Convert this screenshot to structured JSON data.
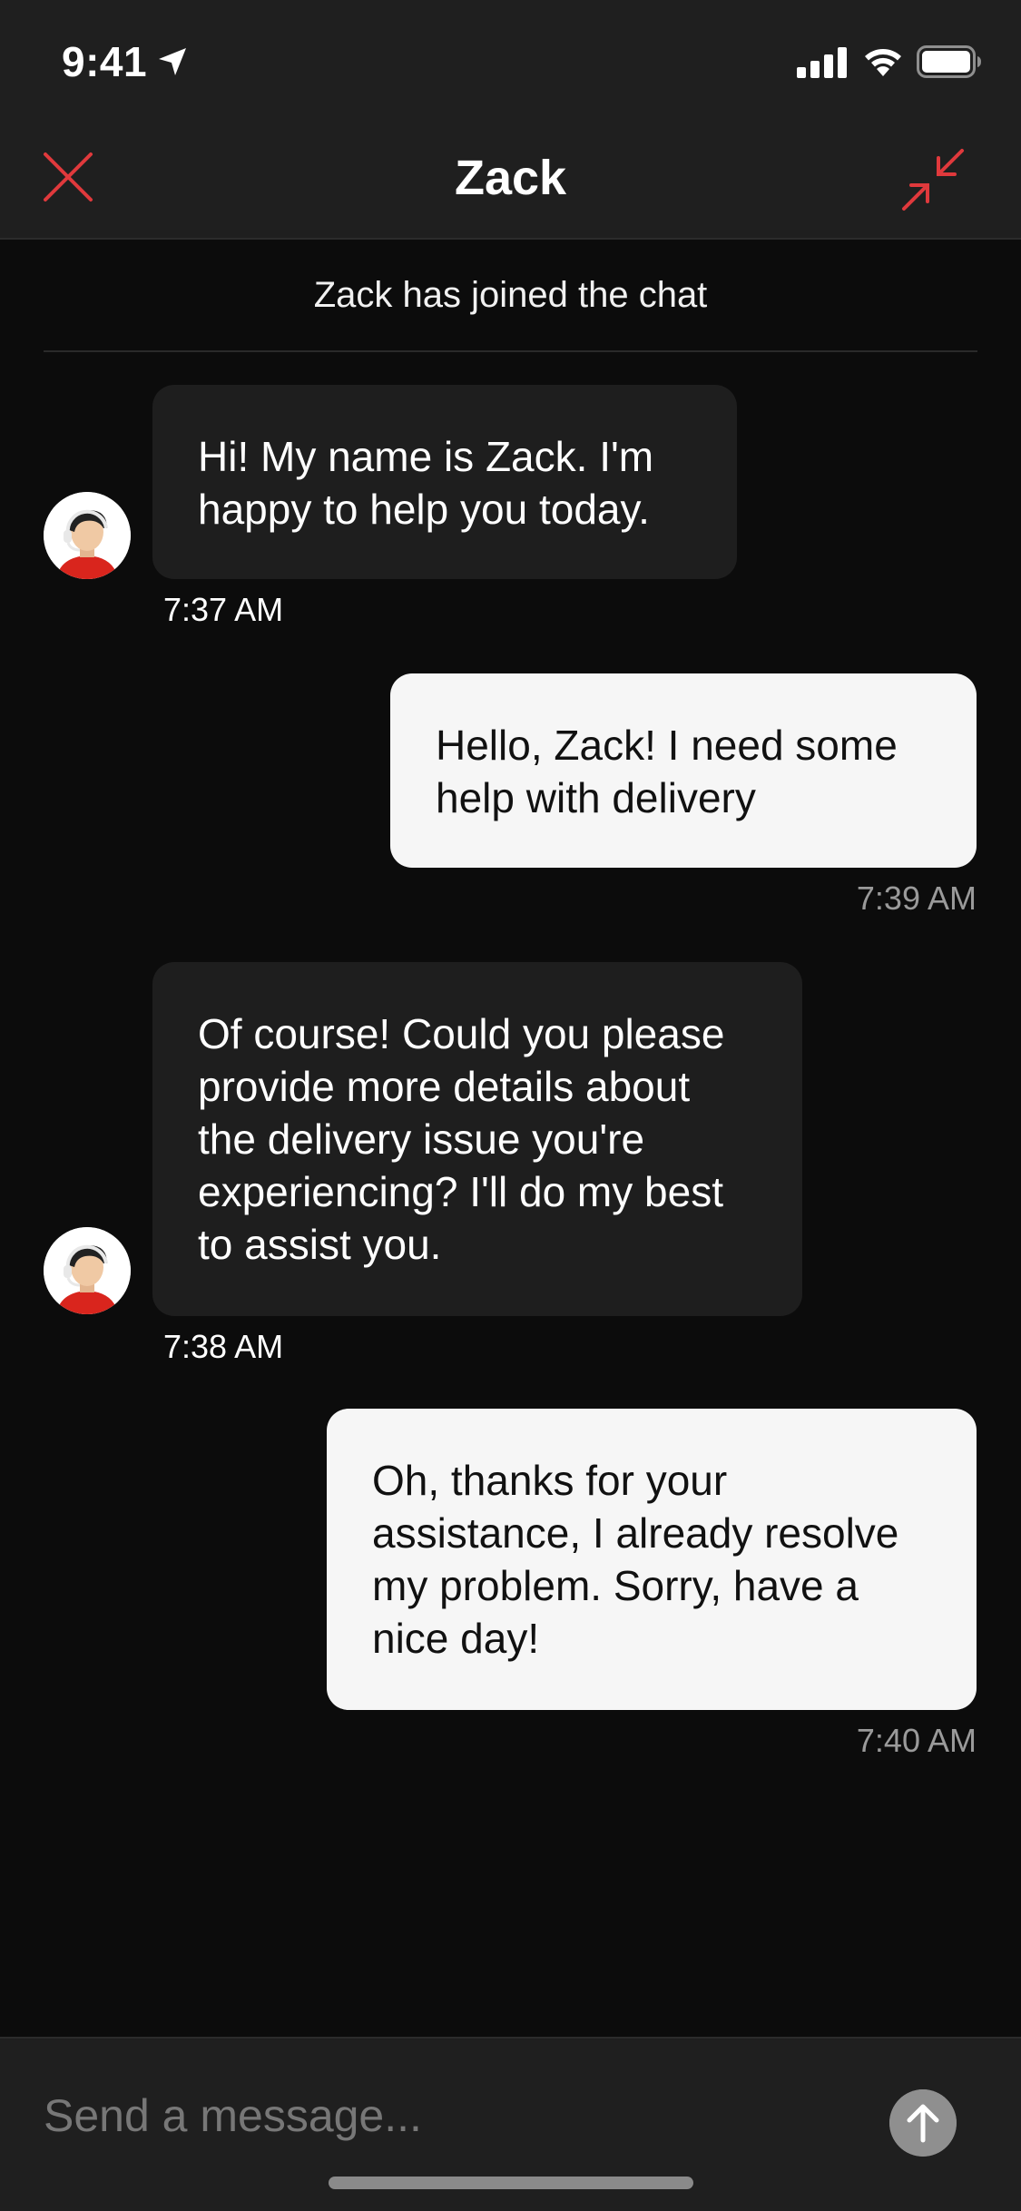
{
  "status_bar": {
    "time": "9:41"
  },
  "header": {
    "title": "Zack"
  },
  "system_message": "Zack has joined the chat",
  "messages": [
    {
      "sender": "agent",
      "text": "Hi! My name is Zack. I'm happy to help you today.",
      "time": "7:37 AM"
    },
    {
      "sender": "user",
      "text": "Hello, Zack! I need some help with delivery",
      "time": "7:39 AM"
    },
    {
      "sender": "agent",
      "text": "Of course! Could you please provide more details about the delivery issue you're experiencing? I'll do my best to assist you.",
      "time": "7:38 AM"
    },
    {
      "sender": "user",
      "text": "Oh, thanks for your assistance, I already resolve my problem. Sorry, have a nice day!",
      "time": "7:40 AM"
    }
  ],
  "composer": {
    "placeholder": "Send a message..."
  },
  "colors": {
    "accent": "#e0393c",
    "background": "#0c0c0c",
    "header_bg": "#1f1f1f",
    "agent_bubble": "#1e1e1e",
    "user_bubble": "#f6f6f6"
  },
  "icons": {
    "close": "close-icon",
    "minimize": "minimize-arrows-icon",
    "send": "arrow-up-icon",
    "avatar": "support-agent-avatar-icon"
  }
}
